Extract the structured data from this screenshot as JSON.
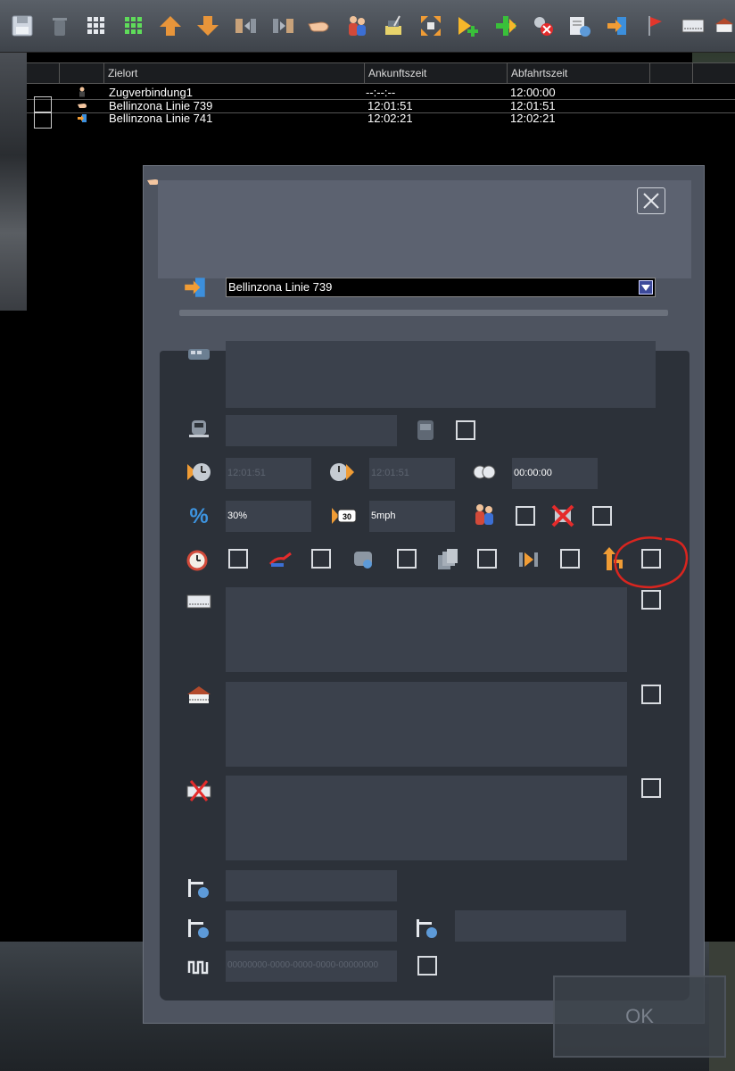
{
  "toolbar": {
    "icons": [
      "save-icon",
      "trash-icon",
      "grid-small-icon",
      "grid-green-icon",
      "arrow-up-icon",
      "arrow-down-icon",
      "split-icon",
      "merge-icon",
      "pointing-hand-icon",
      "passengers-icon",
      "edit-station-icon",
      "expand-icon",
      "add-waypoint-icon",
      "add-icon",
      "remove-icon",
      "settings-list-icon",
      "exit-icon",
      "flag-icon",
      "platform-icon",
      "station-icon"
    ]
  },
  "list": {
    "columns": [
      "",
      "",
      "Zielort",
      "Ankunftszeit",
      "Abfahrtszeit",
      ""
    ],
    "rows": [
      {
        "name": "Zugverbindung1",
        "arrival": "--:--:--",
        "departure": "12:00:00",
        "icon": "person-icon"
      },
      {
        "name": "Bellinzona Linie 739",
        "arrival": "12:01:51",
        "departure": "12:01:51",
        "icon": "pointing-hand-icon"
      },
      {
        "name": "Bellinzona Linie 741",
        "arrival": "12:02:21",
        "departure": "12:02:21",
        "icon": "exit-icon"
      }
    ]
  },
  "dialog": {
    "selected_entry": "Bellinzona Linie 739",
    "arrival_time": "12:01:51",
    "departure_time": "12:01:51",
    "wait_time": "00:00:00",
    "load_percent": "30%",
    "speed_limit": "5mph",
    "uuid": "00000000-0000-0000-0000-00000000",
    "ok_label": "OK"
  },
  "colors": {
    "dialog_bg": "#4e5460",
    "body_bg": "#2c3139",
    "field_bg": "#3b414c",
    "annotation": "#d9251f"
  }
}
